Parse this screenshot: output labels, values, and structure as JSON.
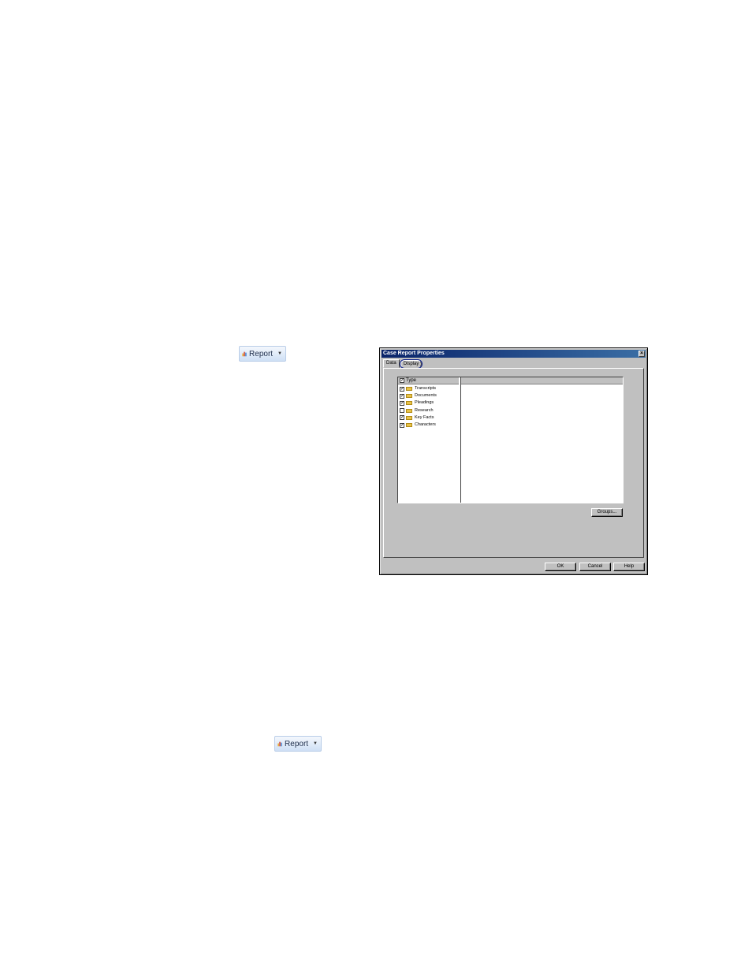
{
  "report_button_top": {
    "label": "Report",
    "icon": "bar-chart-icon"
  },
  "report_button_bottom": {
    "label": "Report",
    "icon": "bar-chart-icon"
  },
  "dialog": {
    "title": "Case Report Properties",
    "close_glyph": "×",
    "tabs": [
      {
        "label": "Data",
        "active": true
      },
      {
        "label": "Display",
        "active": false,
        "highlighted": true
      }
    ],
    "list": {
      "column_header": "Type",
      "header_checked": true,
      "items": [
        {
          "label": "Transcripts",
          "checked": true
        },
        {
          "label": "Documents",
          "checked": true
        },
        {
          "label": "Pleadings",
          "checked": true
        },
        {
          "label": "Research",
          "checked": false
        },
        {
          "label": "Key Facts",
          "checked": true
        },
        {
          "label": "Characters",
          "checked": true
        }
      ]
    },
    "groups_button": "Groups...",
    "ok_button": "OK",
    "cancel_button": "Cancel",
    "help_button": "Help"
  }
}
